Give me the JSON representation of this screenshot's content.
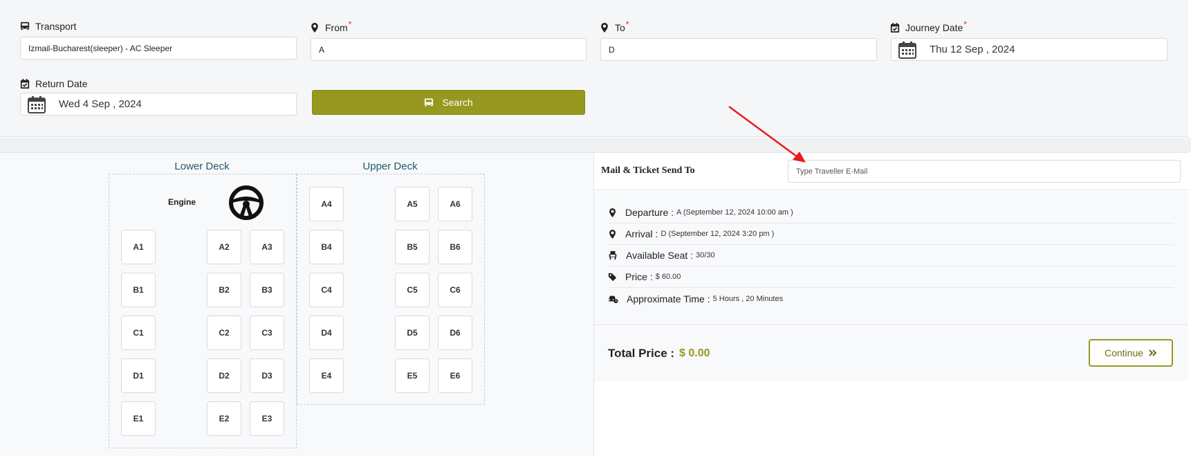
{
  "search": {
    "transport_label": "Transport",
    "transport_value": "Izmail-Bucharest(sleeper)  -  AC Sleeper",
    "from_label": "From",
    "from_value": "A",
    "to_label": "To",
    "to_value": "D",
    "journey_label": "Journey Date",
    "journey_value": "Thu 12 Sep , 2024",
    "return_label": "Return Date",
    "return_value": "Wed 4 Sep , 2024",
    "required_mark": "*",
    "search_button": "Search"
  },
  "seat_map": {
    "lower_title": "Lower Deck",
    "upper_title": "Upper Deck",
    "engine_label": "Engine",
    "lower_seats": [
      "A1",
      "A2",
      "A3",
      "B1",
      "B2",
      "B3",
      "C1",
      "C2",
      "C3",
      "D1",
      "D2",
      "D3",
      "E1",
      "E2",
      "E3"
    ],
    "upper_seats": [
      "A4",
      "A5",
      "A6",
      "B4",
      "B5",
      "B6",
      "C4",
      "C5",
      "C6",
      "D4",
      "D5",
      "D6",
      "E4",
      "E5",
      "E6"
    ]
  },
  "info": {
    "mail_label": "Mail & Ticket Send To",
    "mail_placeholder": "Type Traveller E-Mail",
    "departure_label": "Departure :",
    "departure_value": "A (September 12, 2024 10:00 am )",
    "arrival_label": "Arrival :",
    "arrival_value": "D (September 12, 2024 3:20 pm )",
    "seat_label": "Available Seat :",
    "seat_value": "30/30",
    "price_label": "Price :",
    "price_value": "$ 60.00",
    "time_label": "Approximate Time :",
    "time_value": "5 Hours , 20 Minutes",
    "total_label": "Total Price :",
    "total_value": "$ 0.00",
    "continue_button": "Continue"
  },
  "colors": {
    "accent": "#96981f",
    "deck_title": "#1f5a66",
    "annotation_arrow": "#e81c1c"
  },
  "icons": [
    "bus-icon",
    "map-pin-icon",
    "calendar-check-icon",
    "calendar-icon",
    "steering-wheel-icon",
    "seat-icon",
    "tag-icon",
    "car-clock-icon",
    "double-chevron-right-icon",
    "annotation-arrow"
  ]
}
